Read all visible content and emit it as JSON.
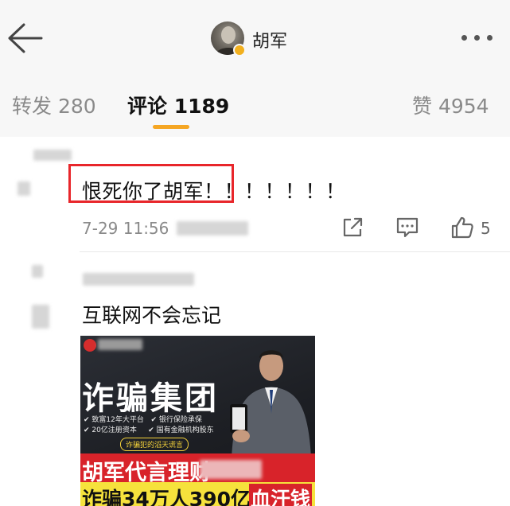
{
  "header": {
    "title": "胡军",
    "back_icon": "arrow-left-icon",
    "more_icon": "more-dots-icon"
  },
  "tabs": [
    {
      "label": "转发",
      "count": "280"
    },
    {
      "label": "评论",
      "count": "1189",
      "active": true
    },
    {
      "label": "赞",
      "count": "4954"
    }
  ],
  "tab_text": {
    "repost": "转发 280",
    "comments": "评论 1189",
    "likes": "赞 4954"
  },
  "comments": [
    {
      "text": "恨死你了胡军！！！！！！！",
      "time": "7-29 11:56",
      "likes": "5",
      "highlighted": true
    },
    {
      "text": "互联网不会忘记",
      "image": {
        "headline": "诈骗集团",
        "bullets": [
          "✔ 致富12年大平台",
          "✔ 20亿注册资本",
          "✔ 银行保险承保",
          "✔ 国有金融机构股东"
        ],
        "pill": "诈骗犯的滔天谎言",
        "line1": "胡军代言理财",
        "line2": "诈骗34万人390亿",
        "line2_tag": "血汗钱"
      }
    }
  ],
  "colors": {
    "accent": "#f5a623",
    "highlight_box": "#e8262b",
    "poster_red": "#d8232a",
    "poster_yellow": "#f6e23c"
  }
}
